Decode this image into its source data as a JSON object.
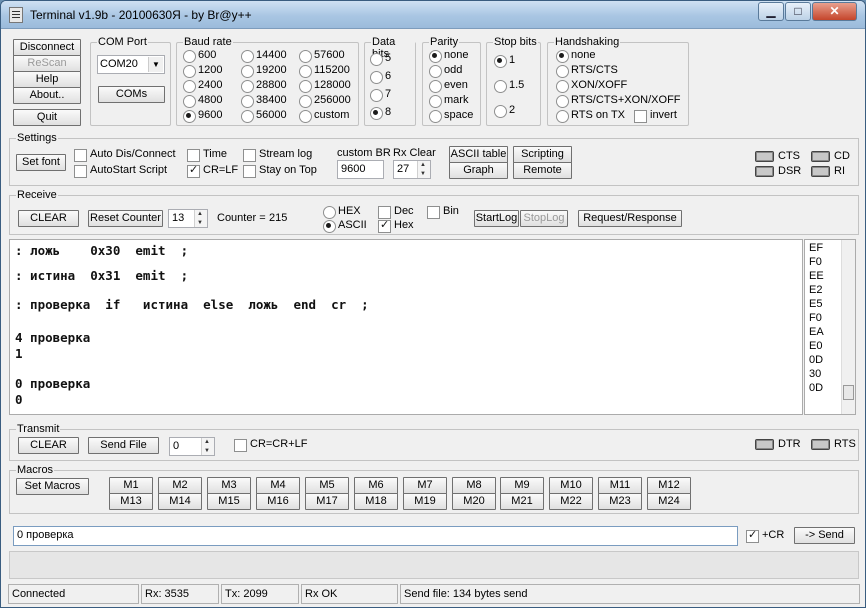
{
  "window": {
    "title": "Terminal v1.9b - 20100630Я - by Br@y++",
    "minimize": "▁",
    "maximize": "□",
    "close": "✕"
  },
  "left_buttons": {
    "disconnect": "Disconnect",
    "rescan": "ReScan",
    "help": "Help",
    "about": "About..",
    "quit": "Quit"
  },
  "com_port": {
    "label": "COM Port",
    "value": "COM20",
    "coms_button": "COMs"
  },
  "baud": {
    "label": "Baud rate",
    "options": [
      "600",
      "1200",
      "2400",
      "4800",
      "9600",
      "14400",
      "19200",
      "28800",
      "38400",
      "56000",
      "57600",
      "115200",
      "128000",
      "256000",
      "custom"
    ],
    "selected": "9600"
  },
  "data_bits": {
    "label": "Data bits",
    "options": [
      "5",
      "6",
      "7",
      "8"
    ],
    "selected": "8"
  },
  "parity": {
    "label": "Parity",
    "options": [
      "none",
      "odd",
      "even",
      "mark",
      "space"
    ],
    "selected": "none"
  },
  "stop_bits": {
    "label": "Stop bits",
    "options": [
      "1",
      "1.5",
      "2"
    ],
    "selected": "1"
  },
  "handshaking": {
    "label": "Handshaking",
    "options": [
      "none",
      "RTS/CTS",
      "XON/XOFF",
      "RTS/CTS+XON/XOFF",
      "RTS on TX"
    ],
    "selected": "none",
    "invert": "invert"
  },
  "settings": {
    "label": "Settings",
    "set_font": "Set font",
    "auto_dis": "Auto Dis/Connect",
    "autostart": "AutoStart Script",
    "time": "Time",
    "crlf": "CR=LF",
    "stream_log": "Stream log",
    "stay_on_top": "Stay on Top",
    "custom_br_label": "custom BR",
    "custom_br_value": "9600",
    "rx_clear_label": "Rx Clear",
    "rx_clear_value": "27",
    "ascii_table": "ASCII table",
    "graph": "Graph",
    "scripting": "Scripting",
    "remote": "Remote",
    "leds": {
      "cts": "CTS",
      "cd": "CD",
      "dsr": "DSR",
      "ri": "RI"
    }
  },
  "receive": {
    "label": "Receive",
    "clear": "CLEAR",
    "reset_counter": "Reset Counter",
    "counter_spin": "13",
    "counter_label": "Counter =",
    "counter_value": "215",
    "hex": "HEX",
    "ascii": "ASCII",
    "dec": "Dec",
    "hex_chk": "Hex",
    "bin": "Bin",
    "start_log": "StartLog",
    "stop_log": "StopLog",
    "request_response": "Request/Response"
  },
  "terminal_lines": [
    ": ложь    0x30  emit  ;",
    ": истина  0x31  emit  ;",
    ": проверка  if   истина  else  ложь  end  cr  ;",
    "4 проверка",
    "1",
    "0 проверка",
    "0"
  ],
  "hex_values": [
    "EF",
    "F0",
    "EE",
    "E2",
    "E5",
    "F0",
    "EA",
    "E0",
    "0D",
    "30",
    "0D"
  ],
  "transmit": {
    "label": "Transmit",
    "clear": "CLEAR",
    "send_file": "Send File",
    "spin_value": "0",
    "crcrlf": "CR=CR+LF",
    "dtr": "DTR",
    "rts": "RTS"
  },
  "macros": {
    "label": "Macros",
    "set_macros": "Set Macros",
    "row1": [
      "M1",
      "M2",
      "M3",
      "M4",
      "M5",
      "M6",
      "M7",
      "M8",
      "M9",
      "M10",
      "M11",
      "M12"
    ],
    "row2": [
      "M13",
      "M14",
      "M15",
      "M16",
      "M17",
      "M18",
      "M19",
      "M20",
      "M21",
      "M22",
      "M23",
      "M24"
    ]
  },
  "send": {
    "input": "0 проверка",
    "cr": "+CR",
    "send_button": "-> Send"
  },
  "status": {
    "connected": "Connected",
    "rx": "Rx: 3535",
    "tx": "Tx: 2099",
    "rxok": "Rx OK",
    "sendfile": "Send file: 134 bytes send"
  }
}
